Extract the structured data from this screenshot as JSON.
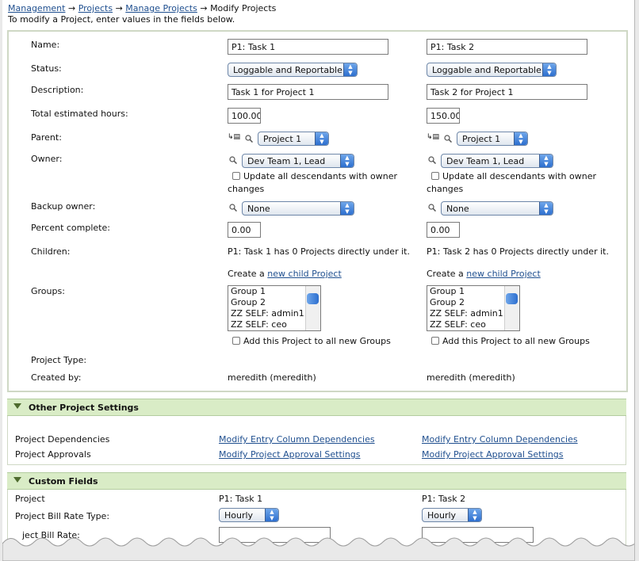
{
  "breadcrumb": {
    "items": [
      "Management",
      "Projects",
      "Manage Projects"
    ],
    "sep": "→",
    "current": "Modify Projects"
  },
  "intro": "To modify a Project, enter values in the fields below.",
  "labels": {
    "name": "Name:",
    "status": "Status:",
    "description": "Description:",
    "hours": "Total estimated hours:",
    "parent": "Parent:",
    "owner": "Owner:",
    "backup": "Backup owner:",
    "percent": "Percent complete:",
    "children": "Children:",
    "groups": "Groups:",
    "ptype": "Project Type:",
    "created": "Created by:"
  },
  "col1": {
    "name": "P1:  Task 1",
    "status": "Loggable and Reportable",
    "description": "Task 1 for Project 1",
    "hours": "100.00",
    "parent": "Project 1",
    "owner": "Dev Team 1, Lead",
    "owner_cb": "Update all descendants with owner",
    "owner_cb2": "changes",
    "backup": "None",
    "percent": "0.00",
    "children": "P1: Task 1 has 0 Projects directly under it.",
    "create_a": "Create a",
    "new_child": "new child Project",
    "groups": [
      "Group 1",
      "Group 2",
      "ZZ SELF: admin1",
      "ZZ SELF: ceo"
    ],
    "groups_cb": "Add this Project to all new Groups",
    "created": "meredith (meredith)"
  },
  "col2": {
    "name": "P1:  Task 2",
    "status": "Loggable and Reportable",
    "description": "Task 2 for Project 1",
    "hours": "150.00",
    "parent": "Project 1",
    "owner": "Dev Team 1, Lead",
    "owner_cb": "Update all descendants with owner",
    "owner_cb2": "changes",
    "backup": "None",
    "percent": "0.00",
    "children": "P1: Task 2 has 0 Projects directly under it.",
    "create_a": "Create a",
    "new_child": "new child Project",
    "groups": [
      "Group 1",
      "Group 2",
      "ZZ SELF: admin1",
      "ZZ SELF: ceo"
    ],
    "groups_cb": "Add this Project to all new Groups",
    "created": "meredith (meredith)"
  },
  "other": {
    "title": "Other Project Settings",
    "dep_label": "Project Dependencies",
    "appr_label": "Project Approvals",
    "dep_link": "Modify Entry Column Dependencies",
    "appr_link": "Modify Project Approval Settings"
  },
  "custom": {
    "title": "Custom Fields",
    "project_label": "Project",
    "rate_type_label": "Project Bill Rate Type:",
    "rate_label": "ject Bill Rate:",
    "col1_project": "P1: Task 1",
    "col2_project": "P1: Task 2",
    "col1_rate_type": "Hourly",
    "col2_rate_type": "Hourly"
  }
}
